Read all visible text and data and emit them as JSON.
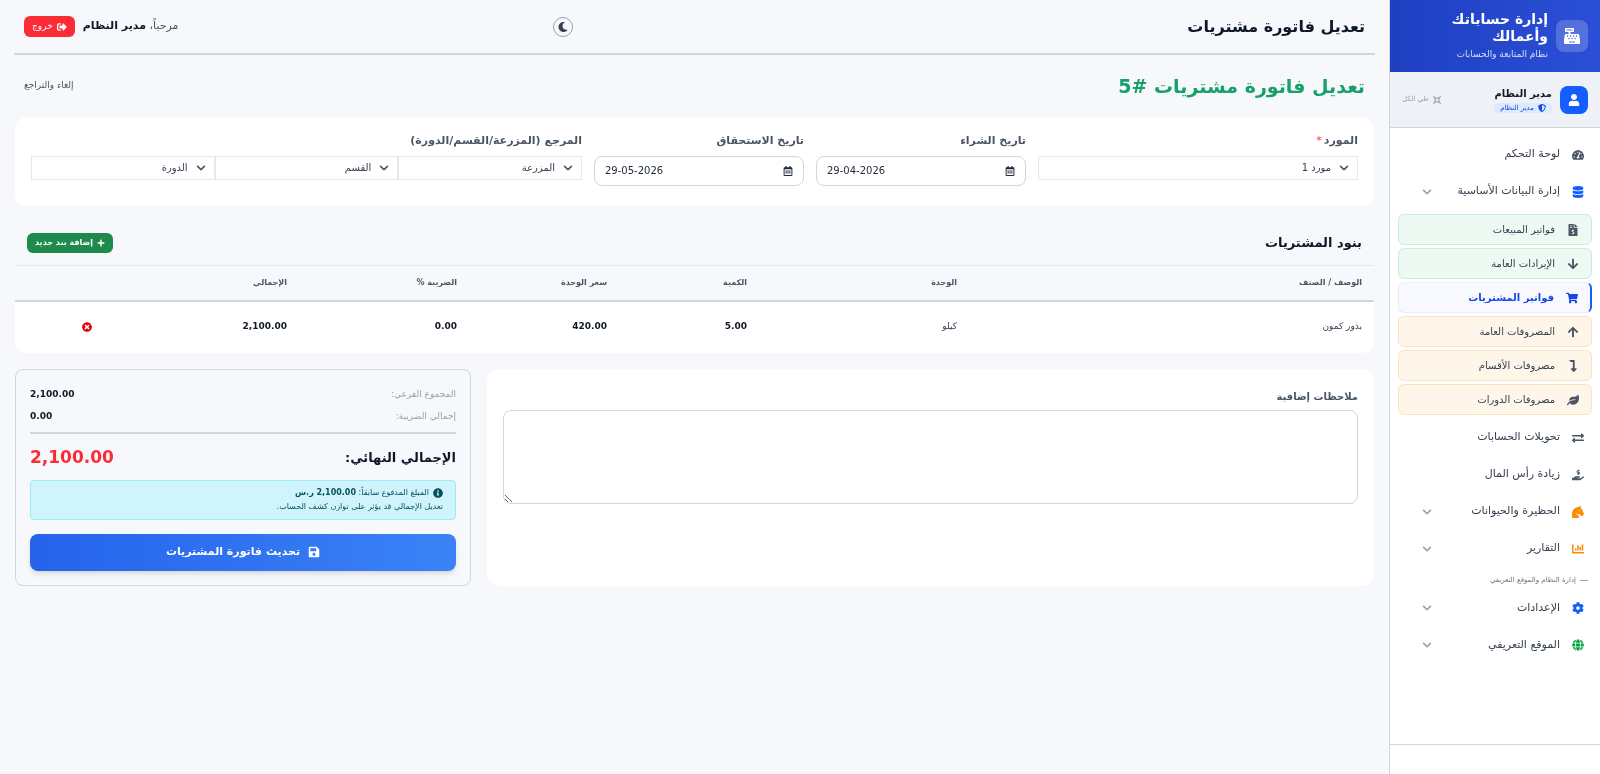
{
  "sidebar": {
    "brand": {
      "title": "إدارة حساباتك وأعمالك",
      "subtitle": "نظام المتابعة والحسابات"
    },
    "user": {
      "name": "مدير النظام",
      "role": "مدير النظام",
      "collapse": "طي الكل"
    },
    "items": [
      {
        "kind": "link",
        "label": "لوحة التحكم",
        "selected": false
      },
      {
        "kind": "group",
        "label": "إدارة البيانات الأساسية",
        "children": [
          {
            "label": "فواتير المبيعات",
            "selected": false,
            "color": "#c8eedb"
          },
          {
            "label": "الإيرادات العامة",
            "selected": false,
            "color": "#c8eedb"
          },
          {
            "label": "فواتير المشتريات",
            "selected": true,
            "color": "#e8edfb"
          },
          {
            "label": "المصروفات العامة",
            "selected": false,
            "color": "#fbe3bd"
          },
          {
            "label": "مصروفات الأقسام",
            "selected": false,
            "color": "#fbe3bd"
          },
          {
            "label": "مصروفات الدورات",
            "selected": false,
            "color": "#fbe3bd"
          }
        ]
      },
      {
        "kind": "link",
        "label": "تحويلات الحسابات",
        "selected": false
      },
      {
        "kind": "link",
        "label": "زيادة رأس المال",
        "selected": false
      },
      {
        "kind": "group",
        "label": "الحظيرة والحيوانات"
      },
      {
        "kind": "group",
        "label": "التقارير"
      },
      {
        "kind": "section",
        "label": "إدارة النظام والموقع التعريفي"
      },
      {
        "kind": "group",
        "label": "الإعدادات"
      },
      {
        "kind": "group",
        "label": "الموقع التعريفي"
      }
    ]
  },
  "header": {
    "title": "تعديل فاتورة مشتريات",
    "welcome": "مرحباً،",
    "user": "مدير النظام",
    "logout": "خروج"
  },
  "page": {
    "heading": "تعديل فاتورة مشتريات #5",
    "cancel": "إلغاء والتراجع"
  },
  "form": {
    "supplier": {
      "label": "المورد",
      "required": true,
      "required_mark": "*",
      "value": "مورد 1"
    },
    "purchase_date": {
      "label": "تاريخ الشراء",
      "value": "29-04-2026"
    },
    "due_date": {
      "label": "تاريخ الاستحقاق",
      "value": "29-05-2026"
    },
    "reference": {
      "label": "المرجع (المزرعة/القسم/الدورة)",
      "selects": [
        "المزرعة",
        "القسم",
        "الدورة"
      ]
    }
  },
  "items": {
    "title": "بنود المشتريات",
    "add_button": "إضافة بند جديد",
    "columns": [
      "الوصف / الصنف",
      "الوحدة",
      "الكمية",
      "سعر الوحدة",
      "الضريبة %",
      "الإجمالي"
    ],
    "rows": [
      {
        "cells": [
          "بذور كمون",
          "كيلو",
          "5.00",
          "420.00",
          "0.00",
          "2,100.00"
        ]
      }
    ]
  },
  "notes": {
    "label": "ملاحظات إضافية"
  },
  "summary": {
    "subtotal_label": "المجموع الفرعي:",
    "subtotal": "2,100.00",
    "tax_label": "إجمالي الضريبة:",
    "tax": "0.00",
    "total_label": "الإجمالي النهائي:",
    "total": "2,100.00",
    "alert": "المبلغ المدفوع سابقاً: **2,100.00 ر.س**",
    "alert_note": "تعديل الإجمالي قد يؤثر على توازن كشف الحساب.",
    "submit": "تحديث فاتورة المشتريات"
  }
}
